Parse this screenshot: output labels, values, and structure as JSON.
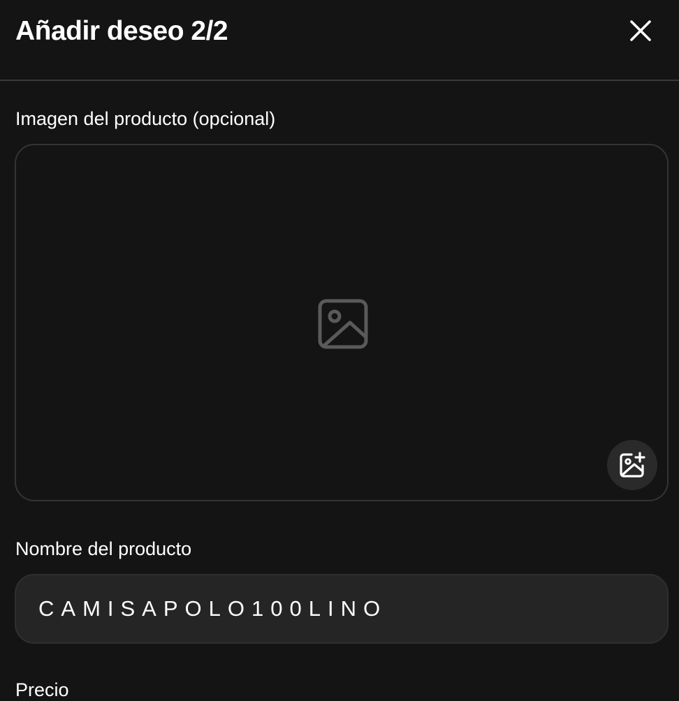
{
  "header": {
    "title": "Añadir deseo 2/2",
    "close_icon": "close-icon"
  },
  "image_section": {
    "label": "Imagen del producto (opcional)",
    "placeholder_icon": "image-icon",
    "add_button_icon": "add-photo-icon"
  },
  "name_section": {
    "label": "Nombre del producto",
    "value": "CAMISAPOLO100LINO"
  },
  "price_section": {
    "label": "Precio"
  },
  "colors": {
    "background": "#141414",
    "input_background": "#252525",
    "border": "#343434",
    "text": "#ffffff",
    "icon_muted": "#5a5a5a"
  }
}
